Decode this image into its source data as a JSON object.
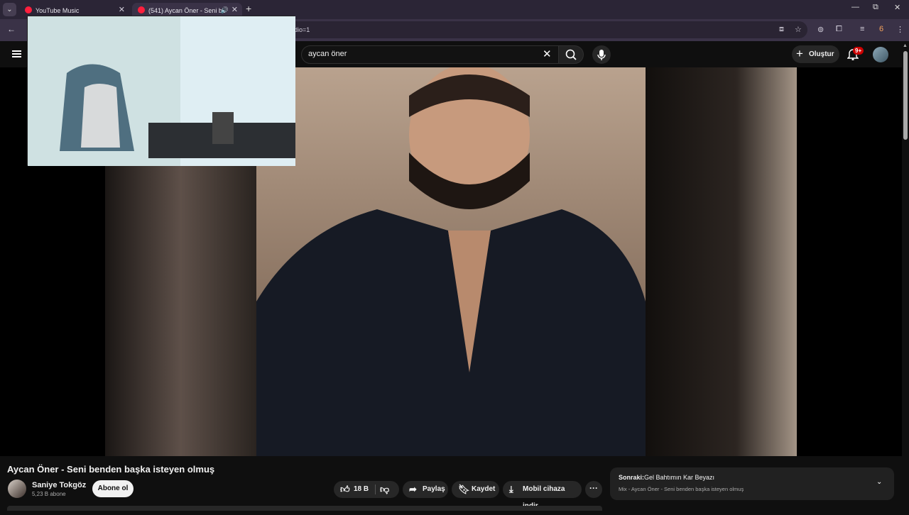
{
  "browser": {
    "tabs": [
      {
        "title": "YouTube Music"
      },
      {
        "title": "(541) Aycan Öner - Seni be"
      }
    ],
    "url_tail": "dio=1",
    "profile_badge": "6"
  },
  "youtube": {
    "search": {
      "value": "aycan öner"
    },
    "create_label": "Oluştur",
    "notifications_badge": "9+"
  },
  "video": {
    "title": "Aycan Öner - Seni benden başka isteyen olmuş",
    "channel": {
      "name": "Saniye Tokgöz",
      "subscribers": "5,23 B abone"
    },
    "subscribe_label": "Abone ol",
    "actions": {
      "likes": "18 B",
      "share": "Paylaş",
      "save": "Kaydet",
      "download": "Mobil cihaza indir"
    }
  },
  "up_next": {
    "label": "Sonraki:",
    "title": "Gel Bahtımın Kar Beyazı",
    "subtitle": "Mix - Aycan Öner - Seni benden başka isteyen olmuş"
  },
  "colors": {
    "accent": "#ff0000",
    "tabbar": "#2b2536",
    "page_bg": "#0f0f0f"
  }
}
